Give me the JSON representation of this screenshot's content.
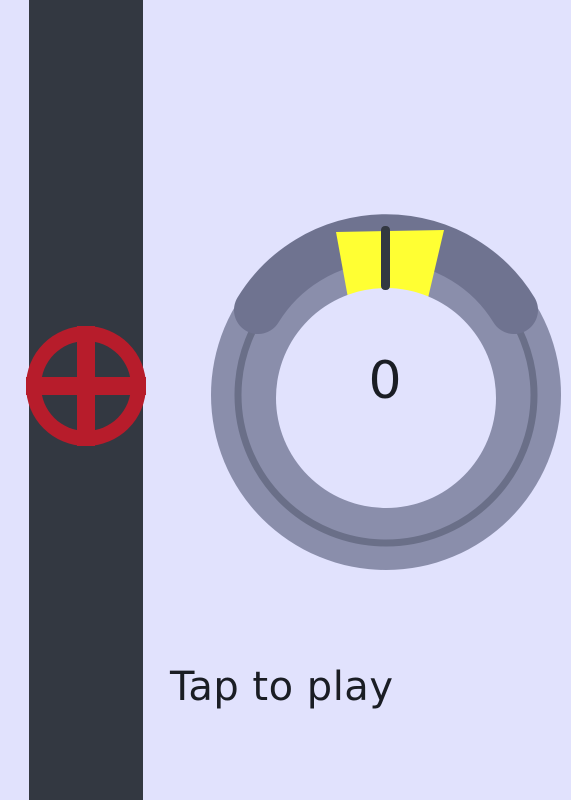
{
  "game": {
    "score": "0",
    "prompt": "Tap to play",
    "progress": 0
  },
  "colors": {
    "background": "#e1e2fd",
    "track": "#333841",
    "puck": "#b71c2b",
    "ring_outer": "#8a8eab",
    "ring_inner_line": "#6a6f88",
    "ring_arc": "#6f7390",
    "target_zone": "#ffff33",
    "needle": "#333841"
  },
  "icons": {
    "puck": "crosshair-wheel-icon",
    "needle": "needle-icon"
  }
}
